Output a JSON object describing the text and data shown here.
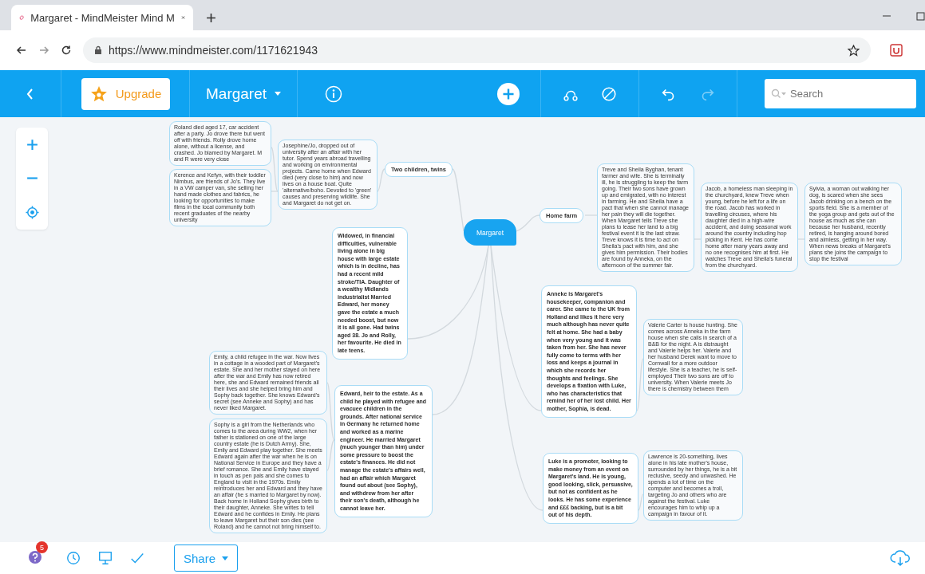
{
  "browser": {
    "tab_title": "Margaret - MindMeister Mind M",
    "url": "https://www.mindmeister.com/1171621943"
  },
  "toolbar": {
    "upgrade_label": "Upgrade",
    "map_title": "Margaret",
    "redo": {
      "disabled": true
    },
    "search": {
      "placeholder": "Search"
    }
  },
  "nodes": [
    {
      "kind": "note",
      "text": "Roland died aged 17, car accident after a party. Jo drove there but went off with friends. Rolly drove home alone, without a license, and crashed. Jo blamed by Margaret. M and R were very close"
    },
    {
      "kind": "note",
      "text": "Kerence and Kefyn, with their toddler Nimbus, are friends of Jo's. They live in a VW camper van, she selling her hand made clothes and fabrics, he looking for opportunities to make films in the local community both recent graduates of the nearby university"
    },
    {
      "kind": "note",
      "text": "Josephine/Jo, dropped out of university after an affair with her tutor. Spend years abroad travelling and working on environmental projects. Came home when Edward died (very close to him) and now lives on a house boat. Quite 'alternative/boho. Devoted to 'green' causes and preserving wildlife. She and Margaret do not get on."
    },
    {
      "kind": "topic",
      "text": "Two children, twins"
    },
    {
      "kind": "root",
      "text": "Margaret"
    },
    {
      "kind": "topic",
      "text": "Home farm"
    },
    {
      "kind": "note",
      "text": "Treve and Sheila Byghan, tenant farmer and wife. She is terminally ill, he is struggling to keep the farm going. Their two sons have grown up and emigrated, with no interest in farming. He and Sheila have a pact that when she cannot manage her pain they will die together. When Margaret tells Treve she plans to lease her land to a big festival event it is the last straw. Treve knows it is time to act on Sheila's pact with him, and she gives him permission. Their bodies are found by Anneka, on the afternoon of the summer fair."
    },
    {
      "kind": "note",
      "text": "Jacob, a homeless man sleeping in the churchyard, knew Treve when young, before he left for a life on the road. Jacob has worked in travelling circuses, where his daughter died in a high-wire accident, and doing seasonal work around the country including hop picking in Kent. He has come home after many years away and no one recognises him at first. He watches Treve and Sheila's funeral from the churchyard."
    },
    {
      "kind": "note",
      "text": "Sylvia, a woman out walking her dog, is scared when she sees Jacob drinking on a bench on the sports field. She is a member of the yoga group and gets out of the house as much as she can because her husband, recently retired, is hanging around bored and aimless, getting in her way.  When news breaks of Margaret's plans she joins the campaign to stop the festival"
    },
    {
      "kind": "detail",
      "text": "Widowed, in financial difficulties, vulnerable living alone in big house with large estate which is in decline, has had a recent mild stroke/TIA. Daughter of a wealthy Midlands industrialist Married Edward, her money gave the estate a much needed boost, but now it is all gone. Had twins aged 38. Jo and Rolly, her favourite. He died in late teens."
    },
    {
      "kind": "detail",
      "text": "Anneke is Margaret's housekeeper, companion and carer. She came to the UK from Holland and likes it here very much although has never quite felt at home. She had a baby when very young and it was taken from her. She has never fully come to terms with her loss and keeps a journal in which she records her thoughts and feelings. She develops a fixation with Luke, who has characteristics that remind her of her lost child. Her mother, Sophia, is dead."
    },
    {
      "kind": "note",
      "text": "Valerie Carter is house hunting. She comes across Anneka in the farm house when she calls in search of a B&B for the night. A is distraught and Valerie helps her. Valerie and her husband Derek want to move to Cornwall for a more outdoor lifestyle. She is a teacher, he is self-employed Their two sons are off to university. When Valerie meets Jo there is chemistry between them"
    },
    {
      "kind": "note",
      "text": "Emily, a child refugee in the war. Now lives in a cottage in a wooded part of Margaret's estate. She and her mother stayed on here after the war and Emily has now retired here, she and Edward remained friends all their lives and she helped bring him and Sophy back together. She knows Edward's secret (see Anneke and Sophy) and has never liked Margaret."
    },
    {
      "kind": "note",
      "text": "Sophy is a girl from the Netherlands who comes to the area during WW2, when her father is stationed on one of the large country estate (he is Dutch Army). She, Emily and Edward play together. She meets Edward again after the war when he is on National Service in Europe and they have a brief romance. She and Emily have stayed in touch as pen pals and she comes to England to visit in the 1970s. Emily reintroduces her and Edward and they have an affair (he s married to Margaret by now). Back home in Holland Sophy gives birth to their daughter, Anneke. She writes to tell Edward and he confides in Emily. He plans to leave Margaret but their son dies (see Roland) and he cannot not bring himself to."
    },
    {
      "kind": "detail",
      "text": "Edward, heir to the estate. As a child he played with refugee and evacuee children in the grounds. After national service in Germany he returned home and worked as a marine engineer. He married Margaret (much younger than him) under some pressure to boost the estate's finances. He did not manage the estate's affairs well, had an affair which Margaret found out about (see Sophy), and withdrew from her after their son's death, although he cannot leave her."
    },
    {
      "kind": "detail",
      "text": "Luke is a promoter, looking to make money from an event on Margaret's land. He is young, good looking, slick, persuasive, but not as confident as he looks. He has some experience and £££ backing, but is a bit out of his depth."
    },
    {
      "kind": "note",
      "text": "Lawrence is 20-something, lives alone in his late mother's house, surrounded by her things, he is a bit reclusive, seedy and unwashed. He spends a lot of time on the computer and becomes a troll, targeting Jo and others who are against the festival. Luke encourages him to whip up a campaign in favour of it."
    }
  ],
  "bottom_bar": {
    "notification_count": "5",
    "share_label": "Share"
  }
}
